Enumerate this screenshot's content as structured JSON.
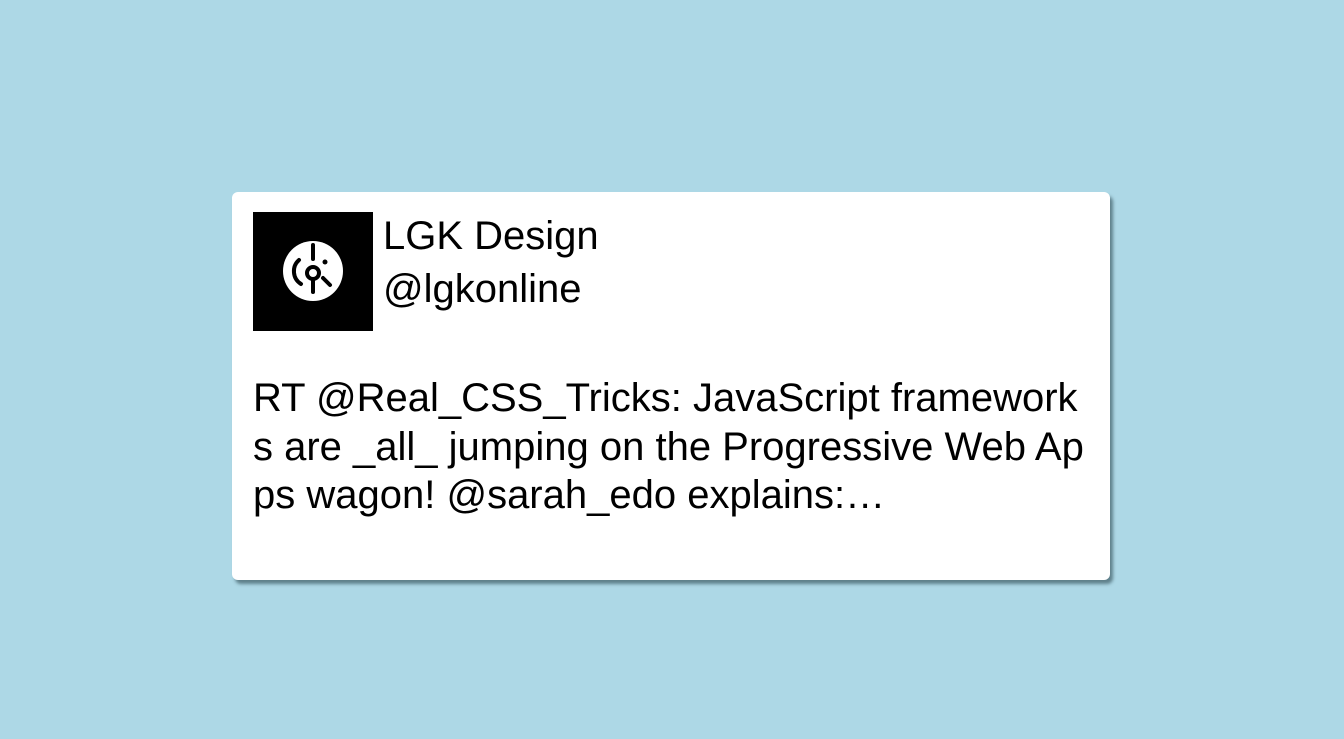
{
  "page": {
    "background_color": "#add8e6"
  },
  "tweet": {
    "author": {
      "name": "LGK Design",
      "handle": "@lgkonline",
      "avatar_icon": "lgk-logo-icon"
    },
    "text": "RT @Real_CSS_Tricks: JavaScript frameworks are _all_ jumping on the Progressive Web Apps wagon! @sarah_edo explains:…"
  }
}
